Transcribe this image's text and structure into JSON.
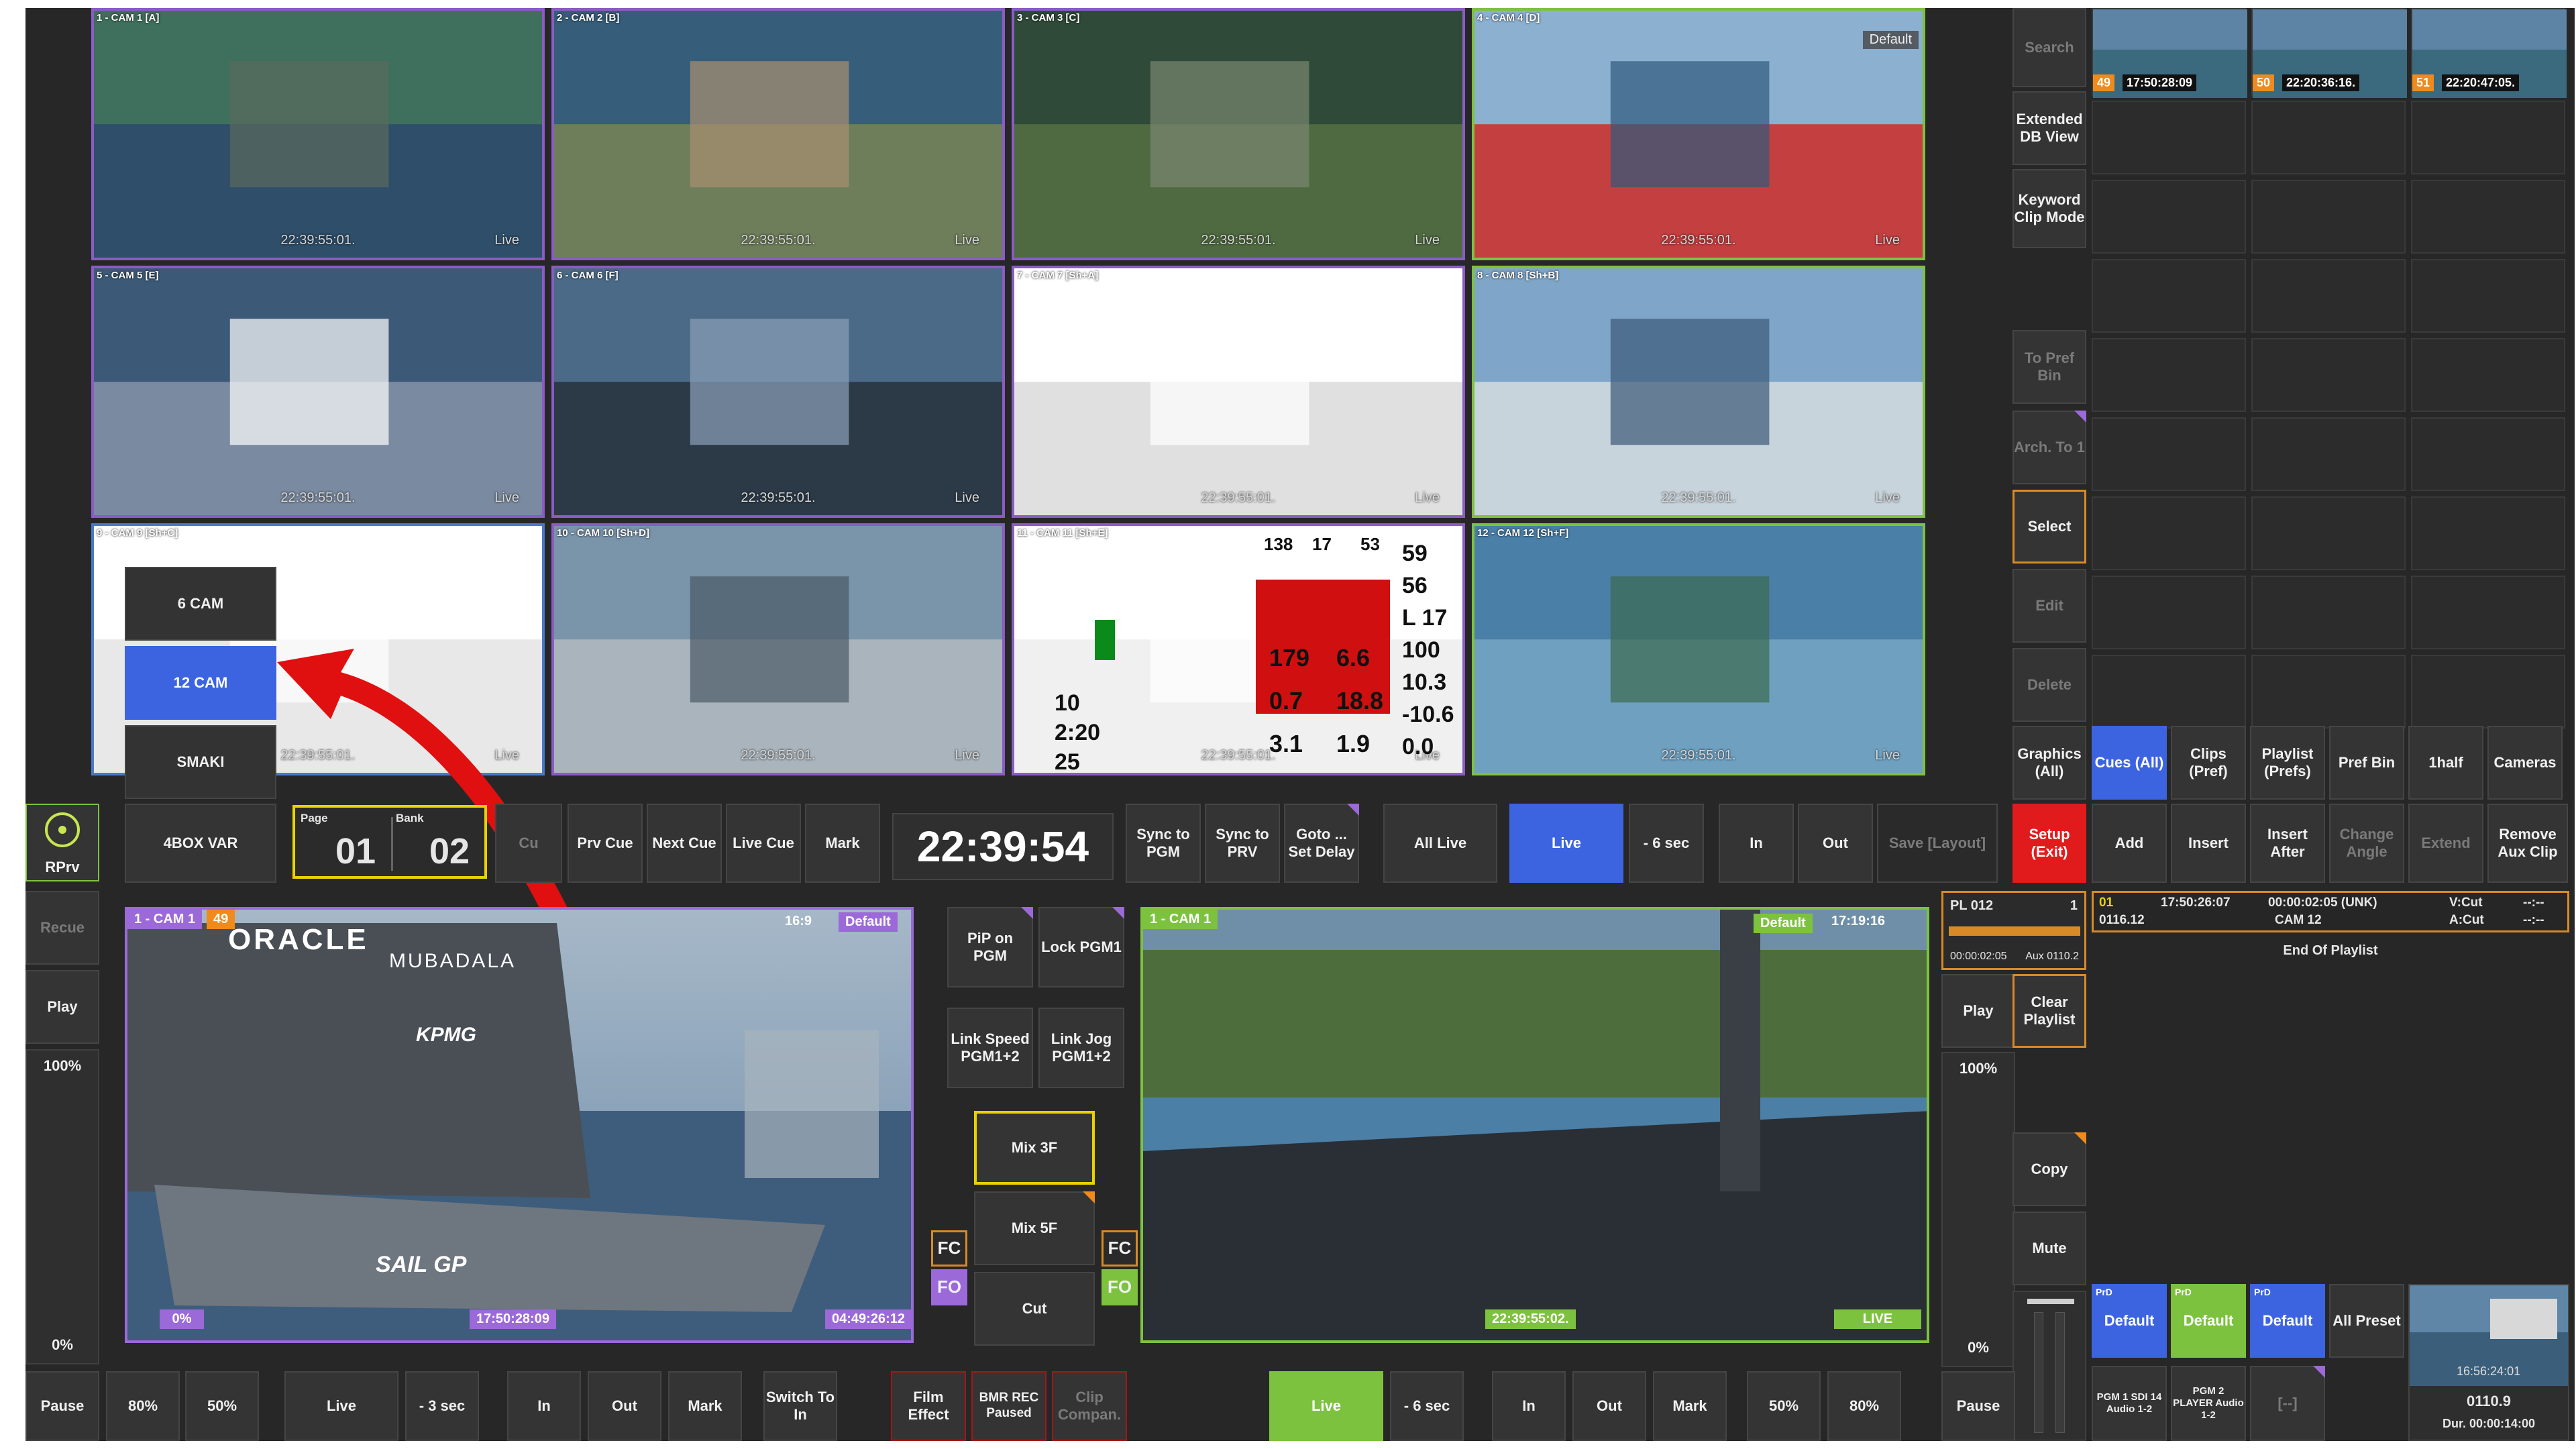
{
  "colors": {
    "purple": "#9b69d8",
    "green": "#7dc23e",
    "blue": "#3d64e0",
    "red": "#e11b1b",
    "orange": "#d88a27",
    "yellow": "#e8d200"
  },
  "multiview": [
    {
      "label": "1 - CAM 1 [A]",
      "tc": "22:39:55:01.",
      "status": "Live",
      "border": "purple"
    },
    {
      "label": "2 - CAM 2 [B]",
      "tc": "22:39:55:01.",
      "status": "Live",
      "border": "purple"
    },
    {
      "label": "3 - CAM 3 [C]",
      "tc": "22:39:55:01.",
      "status": "Live",
      "border": "purple"
    },
    {
      "label": "4 - CAM 4 [D]",
      "tc": "22:39:55:01.",
      "status": "Live",
      "border": "green",
      "tag": "Default"
    },
    {
      "label": "5 - CAM 5 [E]",
      "tc": "22:39:55:01.",
      "status": "Live",
      "border": "purple"
    },
    {
      "label": "6 - CAM 6 [F]",
      "tc": "22:39:55:01.",
      "status": "Live",
      "border": "purple"
    },
    {
      "label": "7 - CAM 7 [Sh+A]",
      "tc": "22:39:55:01.",
      "status": "Live",
      "border": "purple"
    },
    {
      "label": "8 - CAM 8 [Sh+B]",
      "tc": "22:39:55:01.",
      "status": "Live",
      "border": "green"
    },
    {
      "label": "9 - CAM 9 [Sh+C]",
      "tc": "22:39:55:01.",
      "status": "Live",
      "border": "blue"
    },
    {
      "label": "10 - CAM 10 [Sh+D]",
      "tc": "22:39:55:01.",
      "status": "Live",
      "border": "purple"
    },
    {
      "label": "11 - CAM 11 [Sh+E]",
      "tc": "22:39:55:01.",
      "status": "Live",
      "border": "purple"
    },
    {
      "label": "12 - CAM 12 [Sh+F]",
      "tc": "22:39:55:01.",
      "status": "Live",
      "border": "green"
    }
  ],
  "layout_menu": [
    "6 CAM",
    "12 CAM",
    "SMAKI",
    "4BOX VAR"
  ],
  "data_overlay": {
    "nums_top": [
      "138",
      "17",
      "53"
    ],
    "big_values": [
      "59",
      "56",
      "L 17",
      "100",
      "10.3",
      "-10.6",
      "0.0"
    ],
    "mid_values": [
      "179",
      "6.6",
      "0.7",
      "18.8",
      "3.1",
      "1.9"
    ],
    "left_values": [
      "10",
      "2:20",
      "25"
    ]
  },
  "top_right": {
    "search": "Search",
    "extended_db": "Extended DB View",
    "keyword_clip": "Keyword Clip Mode",
    "to_pref_bin": "To Pref Bin",
    "arch_to": "Arch. To 1",
    "select": "Select",
    "edit": "Edit",
    "delete": "Delete",
    "thumbs": [
      {
        "num": "49",
        "time": "17:50:28:09"
      },
      {
        "num": "50",
        "time": "22:20:36:16."
      },
      {
        "num": "51",
        "time": "22:20:47:05."
      }
    ]
  },
  "bin_tabs": [
    "Graphics (All)",
    "Cues (All)",
    "Clips (Pref)",
    "Playlist (Prefs)",
    "Pref Bin",
    "1half",
    "Cameras"
  ],
  "row_left": {
    "rprv": "RPrv",
    "page_label": "Page",
    "bank_label": "Bank",
    "page": "01",
    "bank": "02",
    "cue": "Cu",
    "prv_cue": "Prv Cue",
    "next_cue": "Next Cue",
    "live_cue": "Live Cue",
    "mark": "Mark"
  },
  "clock": "22:39:54",
  "row_mid": {
    "sync_pgm": "Sync to PGM",
    "sync_prv": "Sync to PRV",
    "goto_delay": "Goto ... Set Delay",
    "all_live": "All Live",
    "live": "Live",
    "minus6": "- 6 sec",
    "in": "In",
    "out": "Out",
    "save_layout": "Save [Layout]"
  },
  "row_right": {
    "setup": "Setup (Exit)",
    "add": "Add",
    "insert": "Insert",
    "insert_after": "Insert After",
    "change_angle": "Change Angle",
    "extend": "Extend",
    "remove_aux": "Remove Aux Clip"
  },
  "left_col": {
    "recue": "Recue",
    "play": "Play",
    "pct_top": "100%",
    "pct_bot": "0%",
    "pause": "Pause"
  },
  "pgm": {
    "label": "1 - CAM 1",
    "num": "49",
    "ratio": "16:9",
    "preset": "Default",
    "speed": "0%",
    "tc_in": "17:50:28:09",
    "tc_rem": "04:49:26:12",
    "sponsor1": "ORACLE",
    "sponsor2": "MUBADALA",
    "sponsor3": "KPMG",
    "sponsor4": "SAIL GP"
  },
  "center_btns": {
    "pip": "PiP on PGM",
    "lock": "Lock PGM1",
    "link_speed": "Link Speed PGM1+2",
    "link_jog": "Link Jog PGM1+2",
    "mix3": "Mix 3F",
    "mix5": "Mix 5F",
    "cut": "Cut",
    "fc": "FC",
    "fo": "FO"
  },
  "prv": {
    "label": "1 - CAM 1",
    "preset": "Default",
    "tc": "22:39:55:02.",
    "status": "LIVE",
    "ratio_tc": "17:19:16"
  },
  "right_col": {
    "pl": "PL 012",
    "pl_num": "1",
    "pl_dur": "00:00:02:05",
    "pl_aux": "Aux 0110.2",
    "play": "Play",
    "pct_top": "100%",
    "pct_bot": "0%",
    "pause": "Pause",
    "clear_playlist": "Clear Playlist",
    "copy": "Copy",
    "mute": "Mute"
  },
  "playlist": {
    "row_num": "01",
    "row_tc": "17:50:26:07",
    "row_dur": "00:00:02:05 (UNK)",
    "row_vcut": "V:Cut",
    "row_dash1": "--:--",
    "row_id": "0116.12",
    "row_cam": "CAM 12",
    "row_acut": "A:Cut",
    "row_dash2": "--:--",
    "end": "End Of Playlist"
  },
  "presets": {
    "p1": "Default",
    "p2": "Default",
    "p3": "Default",
    "all": "All Preset",
    "tag": "PrD",
    "pgm1": "PGM 1 SDI 14 Audio 1-2",
    "pgm2": "PGM 2 PLAYER Audio 1-2",
    "bracket": "[--]",
    "thumb_tc": "16:56:24:01",
    "thumb_clip": "0110.9",
    "thumb_dur": "Dur. 00:00:14:00"
  },
  "bottom_row": {
    "pause": "Pause",
    "p80": "80%",
    "p50": "50%",
    "live": "Live",
    "m3": "- 3 sec",
    "in": "In",
    "out": "Out",
    "mark": "Mark",
    "switch": "Switch To In",
    "film": "Film Effect",
    "bmr": "BMR REC Paused",
    "clip_comp": "Clip Compan.",
    "live2": "Live",
    "m6": "- 6 sec",
    "in2": "In",
    "out2": "Out",
    "mark2": "Mark",
    "p50b": "50%",
    "p80b": "80%",
    "pause2": "Pause"
  }
}
